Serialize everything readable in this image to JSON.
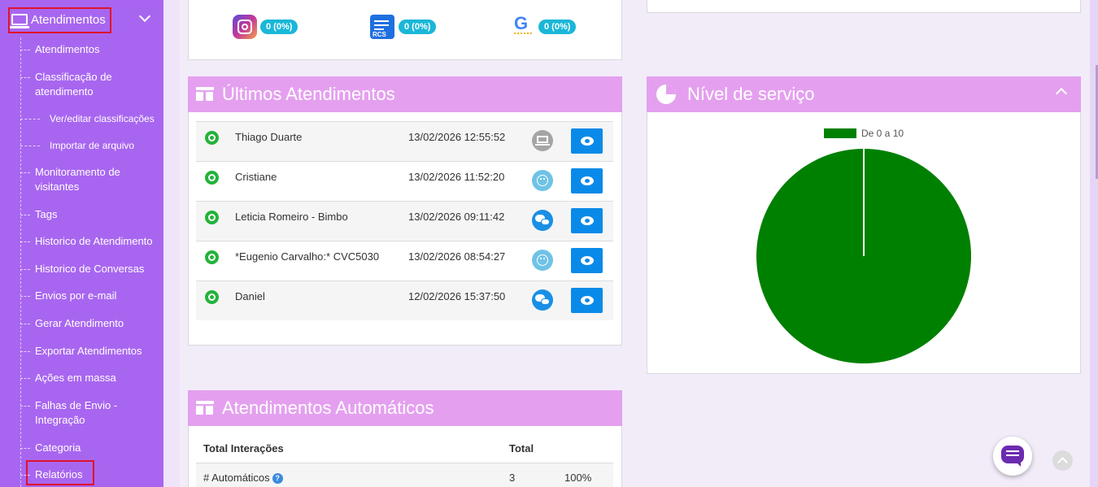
{
  "sidebar": {
    "header_label": "Atendimentos",
    "items": [
      {
        "label": "Atendimentos"
      },
      {
        "label": "Classificação de atendimento"
      },
      {
        "label": "Ver/editar classificações"
      },
      {
        "label": "Importar de arquivo"
      },
      {
        "label": "Monitoramento de visitantes"
      },
      {
        "label": "Tags"
      },
      {
        "label": "Historico de Atendimento"
      },
      {
        "label": "Historico de Conversas"
      },
      {
        "label": "Envios por e-mail"
      },
      {
        "label": "Gerar Atendimento"
      },
      {
        "label": "Exportar Atendimentos"
      },
      {
        "label": "Ações em massa"
      },
      {
        "label": "Falhas de Envio - Integração"
      },
      {
        "label": "Categoria"
      },
      {
        "label": "Relatórios"
      }
    ]
  },
  "channels": [
    {
      "icon": "instagram-icon",
      "badge": "0 (0%)"
    },
    {
      "icon": "rcs-icon",
      "icon_text": "RCS",
      "badge": "0 (0%)"
    },
    {
      "icon": "google-icon",
      "icon_text": "G",
      "badge": "0 (0%)"
    }
  ],
  "ultimos": {
    "title": "Últimos Atendimentos",
    "rows": [
      {
        "name": "Thiago Duarte",
        "date": "13/02/2026 12:55:52",
        "status_icon": "laptop-icon"
      },
      {
        "name": "Cristiane",
        "date": "13/02/2026 11:52:20",
        "status_icon": "sad-face-icon"
      },
      {
        "name": "Leticia Romeiro - Bimbo",
        "date": "13/02/2026 09:11:42",
        "status_icon": "chat-bubbles-icon"
      },
      {
        "name": "*Eugenio Carvalho:* CVC5030",
        "date": "13/02/2026 08:54:27",
        "status_icon": "sad-face-icon"
      },
      {
        "name": "Daniel",
        "date": "12/02/2026 15:37:50",
        "status_icon": "chat-bubbles-icon"
      }
    ]
  },
  "nivel": {
    "title": "Nível de serviço"
  },
  "chart_data": {
    "type": "pie",
    "categories": [
      "De 0 a 10"
    ],
    "values": [
      100
    ],
    "legend": [
      "De 0 a 10"
    ],
    "colors": [
      "#008000"
    ]
  },
  "automaticos": {
    "title": "Atendimentos Automáticos",
    "columns": [
      "Total Interações",
      "Total"
    ],
    "rows": [
      {
        "label": "# Automáticos",
        "total": "3",
        "pct": "100%"
      }
    ]
  },
  "colors": {
    "sidebar": "#a866f0",
    "panel_header": "#e4a0ef",
    "badge": "#1ab7d8",
    "view_button": "#0a8ae8",
    "whatsapp": "#23b33a"
  }
}
